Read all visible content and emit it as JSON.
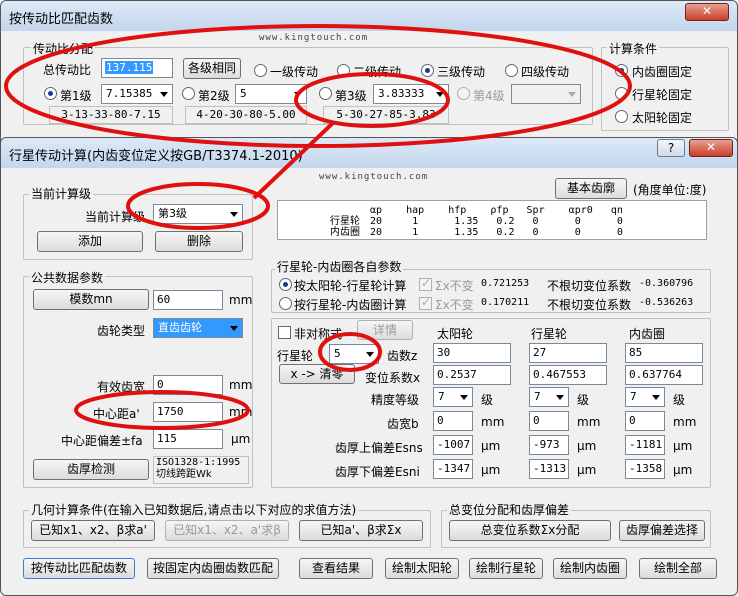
{
  "win1": {
    "title": "按传动比匹配齿数",
    "close": "✕",
    "url": "www.kingtouch.com",
    "ratio_group": "传动比分配",
    "total_ratio_label": "总传动比",
    "total_ratio_value": "137.115",
    "same_stage_button": "各级相同",
    "stage_options": [
      "一级传动",
      "二级传动",
      "三级传动",
      "四级传动"
    ],
    "stage1": {
      "label": "第1级",
      "value": "7.15385",
      "combo": "3-13-33-80-7.15"
    },
    "stage2": {
      "label": "第2级",
      "value": "5",
      "combo": "4-20-30-80-5.00"
    },
    "stage3": {
      "label": "第3级",
      "value": "3.83333",
      "combo": "5-30-27-85-3.83"
    },
    "stage4": {
      "label": "第4级"
    },
    "calc_group": "计算条件",
    "calc_options": [
      "内齿圈固定",
      "行星轮固定",
      "太阳轮固定"
    ]
  },
  "win2": {
    "title": "行星传动计算(内齿变位定义按GB/T3374.1-2010)",
    "help": "?",
    "close": "✕",
    "url": "www.kingtouch.com",
    "basic_rack_button": "基本齿廓",
    "angle_unit": "(角度单位:度)",
    "current_group": "当前计算级",
    "current_label": "当前计算级",
    "current_value": "第3级",
    "add_button": "添加",
    "delete_button": "删除",
    "param_header": "αp    hap    hfp    ρfp   Spr    αpr0   qn",
    "param_rows": [
      {
        "name": "行星轮",
        "values": "20     1      1.35   0.2   0      0      0"
      },
      {
        "name": "内齿圈",
        "values": "20     1      1.35   0.2   0      0      0"
      }
    ],
    "common_group": "公共数据参数",
    "module_button": "模数mn",
    "module_value": "60",
    "module_unit": "mm",
    "gear_type_label": "齿轮类型",
    "gear_type_value": "直齿齿轮",
    "face_width_label": "有效齿宽",
    "face_width_value": "0",
    "face_width_unit": "mm",
    "center_distance_label": "中心距a'",
    "center_distance_value": "1750",
    "center_distance_unit": "mm",
    "cd_tol_label": "中心距偏差±fa",
    "cd_tol_value": "115",
    "cd_tol_unit": "μm",
    "tooth_check_button": "齿厚检测",
    "tooth_check_line1": "ISO1328-1:1995",
    "tooth_check_line2": "切线跨距Wk",
    "shift_group": "行星轮-内齿圈各自参数",
    "shift_opt1": "按太阳轮-行星轮计算",
    "shift_opt2": "按行星轮-内齿圈计算",
    "sigma_label": "Σx不变",
    "sigma1": "0.721253",
    "sigma2": "0.170211",
    "undercut_label": "不根切变位系数",
    "undercut1": "-0.360796",
    "undercut2": "-0.536263",
    "asym_label": "非对称式",
    "detail_button": "详情",
    "planet_count_label": "行星轮",
    "planet_count_value": "5",
    "x_button": "x -> 清零",
    "col_sun": "太阳轮",
    "col_planet": "行星轮",
    "col_ring": "内齿圈",
    "teeth_label": "齿数z",
    "teeth": [
      "30",
      "27",
      "85"
    ],
    "shift_label": "变位系数x",
    "shift": [
      "0.2537",
      "0.467553",
      "0.637764"
    ],
    "grade_label": "精度等级",
    "grade": [
      "7",
      "7",
      "7"
    ],
    "grade_unit": "级",
    "thick_label": "齿宽b",
    "thick": [
      "0",
      "0",
      "0"
    ],
    "thick_unit": "mm",
    "esns_label": "齿厚上偏差Esns",
    "esns": [
      "-1007",
      "-973",
      "-1181"
    ],
    "esni_label": "齿厚下偏差Esni",
    "esni": [
      "-1347",
      "-1313",
      "-1358"
    ],
    "um": "μm",
    "geo_group": "几何计算条件(在输入已知数据后,请点击以下对应的求值方法)",
    "geo_btn1": "已知x1、x2、β求a'",
    "geo_btn2": "已知x1、x2、a'求β",
    "geo_btn3": "已知a'、β求Σx",
    "total_group": "总变位分配和齿厚偏差",
    "total_btn1": "总变位系数Σx分配",
    "total_btn2": "齿厚偏差选择",
    "bottom_buttons": [
      "按传动比匹配齿数",
      "按固定内齿圈齿数匹配",
      "查看结果",
      "绘制太阳轮",
      "绘制行星轮",
      "绘制内齿圈",
      "绘制全部"
    ]
  },
  "annotation_color": "#e01010"
}
